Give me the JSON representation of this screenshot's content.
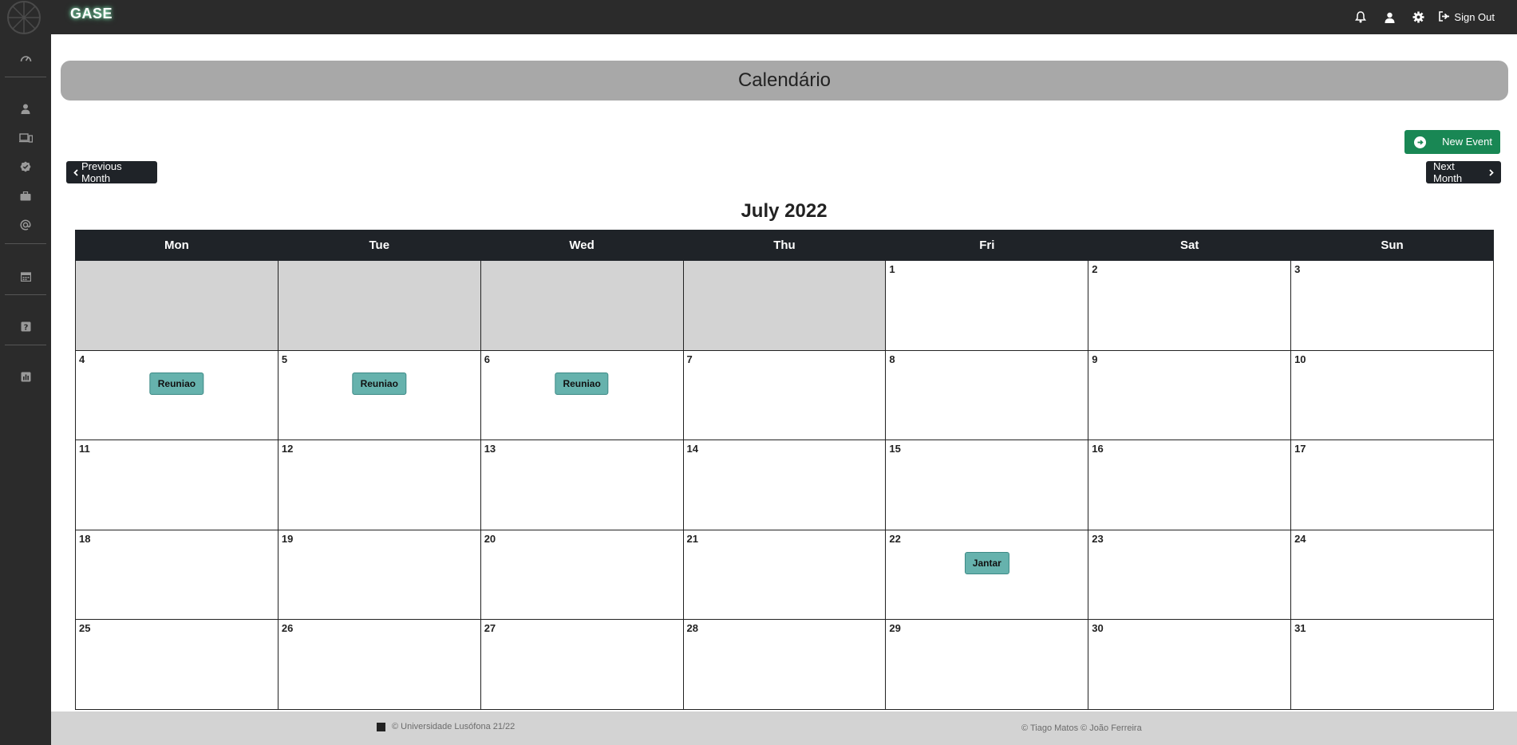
{
  "header": {
    "brand": "GASE",
    "icons": [
      "bell-icon",
      "user-icon",
      "gear-icon",
      "sign-out-icon"
    ],
    "sign_out_label": "Sign Out"
  },
  "sidebar": {
    "items": [
      {
        "icon": "dashboard-icon"
      },
      {
        "icon": "user-icon"
      },
      {
        "icon": "devices-icon"
      },
      {
        "icon": "badge-check-icon"
      },
      {
        "icon": "briefcase-icon"
      },
      {
        "icon": "at-icon"
      },
      {
        "icon": "calendar-icon"
      },
      {
        "icon": "help-icon"
      },
      {
        "icon": "report-icon"
      }
    ]
  },
  "page": {
    "title": "Calendário",
    "new_event_label": "New Event",
    "prev_label": "Previous Month",
    "next_label": "Next Month",
    "month_title": "July 2022"
  },
  "calendar": {
    "weekdays": [
      "Mon",
      "Tue",
      "Wed",
      "Thu",
      "Fri",
      "Sat",
      "Sun"
    ],
    "weeks": [
      [
        null,
        null,
        null,
        null,
        {
          "day": "1"
        },
        {
          "day": "2"
        },
        {
          "day": "3"
        }
      ],
      [
        {
          "day": "4",
          "event": "Reuniao"
        },
        {
          "day": "5",
          "event": "Reuniao"
        },
        {
          "day": "6",
          "event": "Reuniao"
        },
        {
          "day": "7"
        },
        {
          "day": "8"
        },
        {
          "day": "9"
        },
        {
          "day": "10"
        }
      ],
      [
        {
          "day": "11"
        },
        {
          "day": "12"
        },
        {
          "day": "13"
        },
        {
          "day": "14"
        },
        {
          "day": "15"
        },
        {
          "day": "16"
        },
        {
          "day": "17"
        }
      ],
      [
        {
          "day": "18"
        },
        {
          "day": "19"
        },
        {
          "day": "20"
        },
        {
          "day": "21"
        },
        {
          "day": "22",
          "event": "Jantar"
        },
        {
          "day": "23"
        },
        {
          "day": "24"
        }
      ],
      [
        {
          "day": "25"
        },
        {
          "day": "26"
        },
        {
          "day": "27"
        },
        {
          "day": "28"
        },
        {
          "day": "29"
        },
        {
          "day": "30"
        },
        {
          "day": "31"
        }
      ]
    ]
  },
  "footer": {
    "left_text": "© Universidade Lusófona 21/22",
    "right_text": "© Tiago Matos © João Ferreira"
  },
  "colors": {
    "topbar": "#2b2b2b",
    "title_bar": "#a8a8a8",
    "accent_green": "#198754",
    "event_teal": "#66b2ad",
    "empty_cell": "#d3d3d3"
  }
}
